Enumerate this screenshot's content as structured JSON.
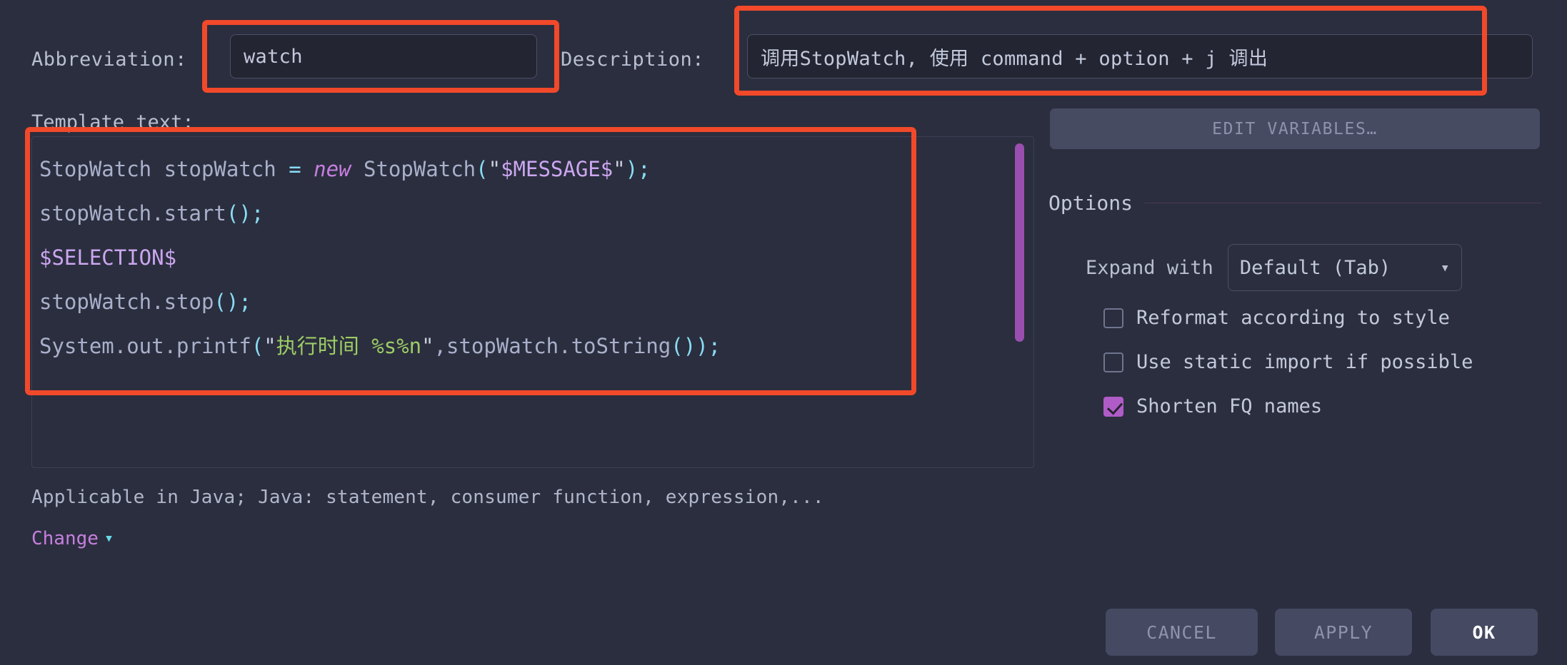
{
  "dialog": {
    "abbreviation": {
      "label": "Abbreviation:",
      "value": "watch",
      "placeholder": ""
    },
    "description": {
      "label": "Description:",
      "value": "调用StopWatch, 使用 command + option + j 调出",
      "placeholder": ""
    },
    "template": {
      "label": "Template text:",
      "lines": [
        {
          "tokens": [
            {
              "text": "StopWatch stopWatch ",
              "type": "plain"
            },
            {
              "text": "=",
              "type": "punct"
            },
            {
              "text": " ",
              "type": "plain"
            },
            {
              "text": "new",
              "type": "kw"
            },
            {
              "text": " StopWatch",
              "type": "plain"
            },
            {
              "text": "(",
              "type": "punct"
            },
            {
              "text": "\"",
              "type": "strq"
            },
            {
              "text": "$MESSAGE$",
              "type": "var"
            },
            {
              "text": "\"",
              "type": "strq"
            },
            {
              "text": ")",
              "type": "punct"
            },
            {
              "text": ";",
              "type": "punct"
            }
          ]
        },
        {
          "tokens": [
            {
              "text": "stopWatch.start",
              "type": "plain"
            },
            {
              "text": "()",
              "type": "punct"
            },
            {
              "text": ";",
              "type": "punct"
            }
          ]
        },
        {
          "tokens": [
            {
              "text": "$SELECTION$",
              "type": "var"
            }
          ]
        },
        {
          "tokens": [
            {
              "text": "stopWatch.stop",
              "type": "plain"
            },
            {
              "text": "()",
              "type": "punct"
            },
            {
              "text": ";",
              "type": "punct"
            }
          ]
        },
        {
          "tokens": [
            {
              "text": "System.out.printf",
              "type": "plain"
            },
            {
              "text": "(",
              "type": "punct"
            },
            {
              "text": "\"",
              "type": "strq"
            },
            {
              "text": "执行时间 %s%n",
              "type": "str"
            },
            {
              "text": "\"",
              "type": "strq"
            },
            {
              "text": ",",
              "type": "plain"
            },
            {
              "text": "stopWatch.toString",
              "type": "plain"
            },
            {
              "text": "())",
              "type": "punct"
            },
            {
              "text": ";",
              "type": "punct"
            }
          ]
        }
      ]
    },
    "applicable": {
      "text": "Applicable in Java; Java: statement, consumer function, expression,...",
      "change_label": "Change",
      "change_chevron": "chevron-down-icon"
    },
    "edit_variables_label": "EDIT VARIABLES…",
    "options": {
      "title": "Options",
      "expand_with": {
        "label": "Expand with",
        "selected": "Default (Tab)",
        "chevron": "chevron-down-icon"
      },
      "checkboxes": [
        {
          "label": "Reformat according to style",
          "checked": false
        },
        {
          "label": "Use static import if possible",
          "checked": false
        },
        {
          "label": "Shorten FQ names",
          "checked": true
        }
      ]
    },
    "buttons": {
      "cancel": "CANCEL",
      "apply": "APPLY",
      "ok": "OK"
    },
    "colors": {
      "background": "#2b2e3e",
      "input_background": "#232532",
      "highlight_red": "#f1492a",
      "accent_purple": "#b05cc8",
      "scrollbar_purple": "#9a4eb0",
      "keyword_purple": "#c77fe0",
      "punct_cyan": "#89ddf5",
      "string_green": "#9ccc65"
    }
  }
}
